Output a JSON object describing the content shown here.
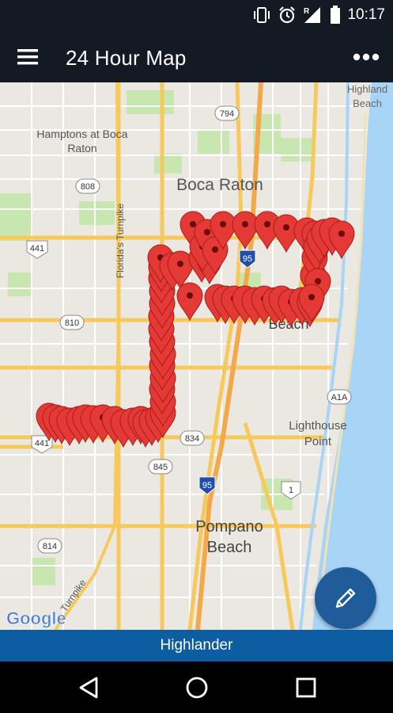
{
  "status_bar": {
    "time": "10:17",
    "icons": [
      "vibrate-icon",
      "alarm-icon",
      "signal-icon",
      "battery-icon"
    ],
    "signal_badge": "R"
  },
  "app_bar": {
    "title": "24 Hour Map",
    "menu_icon": "hamburger-menu-icon",
    "more_icon": "more-options-icon"
  },
  "map": {
    "provider_logo": "Google",
    "city_labels": [
      {
        "name": "Boca Raton"
      },
      {
        "name": "Hamptons at Boca Raton"
      },
      {
        "name": "Deerfield Beach"
      },
      {
        "name": "Lighthouse Point"
      },
      {
        "name": "Pompano Beach"
      },
      {
        "name": "Highland Beach"
      }
    ],
    "road_labels": [
      "Florida's Turnpike",
      "Turnpike"
    ],
    "route_shields": [
      "794",
      "808",
      "441",
      "810",
      "95",
      "834",
      "845",
      "A1A",
      "1",
      "814",
      "441"
    ],
    "markers": {
      "color": "#e53935",
      "icon": "map-pin-icon"
    }
  },
  "fab": {
    "icon": "pencil-icon"
  },
  "bottom_banner": {
    "text": "Highlander"
  },
  "nav_bar": {
    "back_icon": "back-triangle-icon",
    "home_icon": "home-circle-icon",
    "recents_icon": "recents-square-icon"
  },
  "colors": {
    "app_bar": "#141a24",
    "banner": "#0d5da3",
    "fab": "#1f5c99",
    "water": "#a8d4f6",
    "park": "#c8e6b0",
    "major_road": "#f7c95d",
    "marker": "#e53935"
  }
}
